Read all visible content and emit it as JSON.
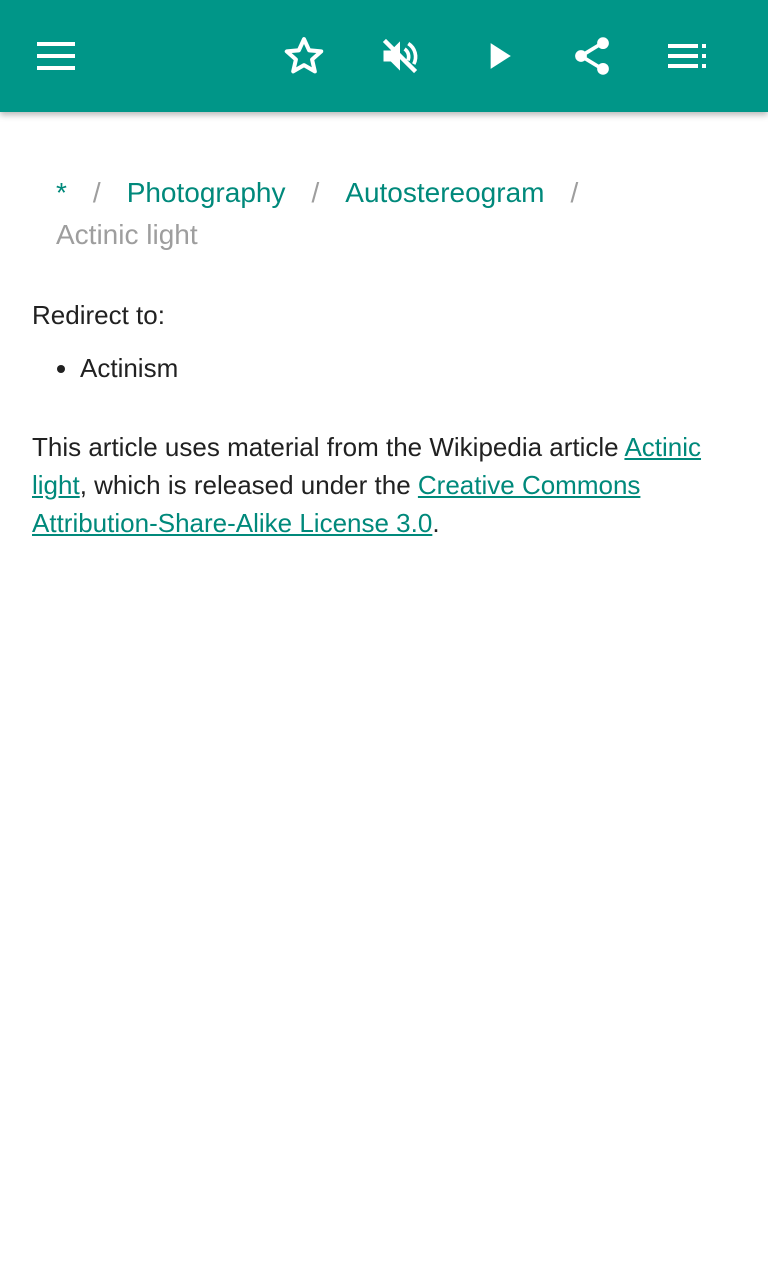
{
  "toolbar": {
    "background_color": "#009688",
    "icons": {
      "menu": "menu-icon",
      "favorite": "star-outline-icon",
      "mute": "volume-off-icon",
      "play": "play-icon",
      "share": "share-icon",
      "playlist": "playlist-icon"
    }
  },
  "breadcrumb": {
    "root": "*",
    "separator": "/",
    "items": [
      "Photography",
      "Autostereogram"
    ],
    "current": "Actinic light"
  },
  "content": {
    "redirect_label": "Redirect to:",
    "redirect_items": [
      "Actinism"
    ],
    "attribution": {
      "prefix": "This article uses material from the Wikipedia article ",
      "article_link": "Actinic light",
      "middle": ", which is released under the ",
      "license_link": "Creative Commons Attribution-Share-Alike License 3.0",
      "suffix": "."
    }
  },
  "colors": {
    "accent": "#009688",
    "link": "#00897b",
    "muted": "#9e9e9e",
    "text": "#212121"
  }
}
